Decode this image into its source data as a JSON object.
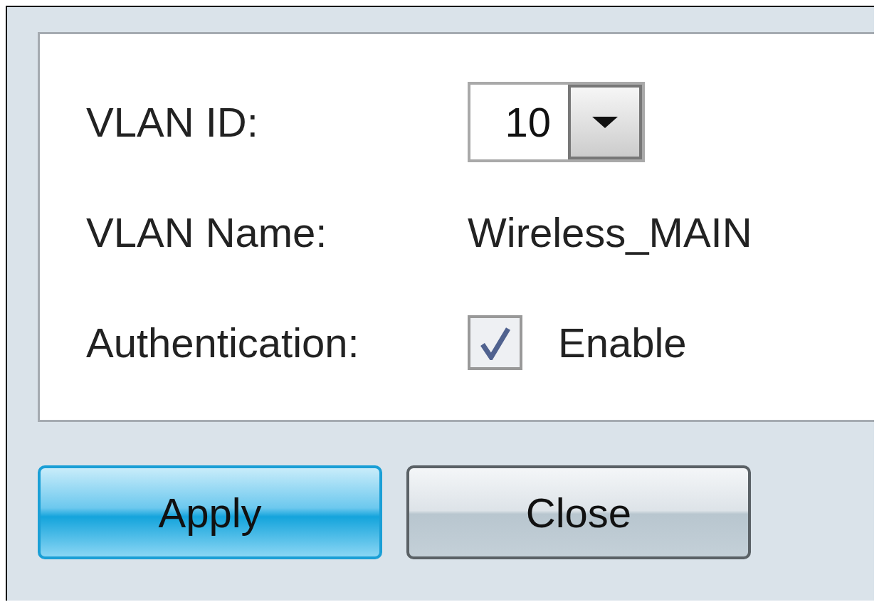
{
  "form": {
    "vlan_id": {
      "label": "VLAN ID:",
      "value": "10"
    },
    "vlan_name": {
      "label": "VLAN Name:",
      "value": "Wireless_MAIN"
    },
    "authentication": {
      "label": "Authentication:",
      "checked": true,
      "option_label": "Enable"
    }
  },
  "buttons": [
    {
      "label": "Apply",
      "kind": "primary"
    },
    {
      "label": "Close",
      "kind": "secondary"
    }
  ]
}
